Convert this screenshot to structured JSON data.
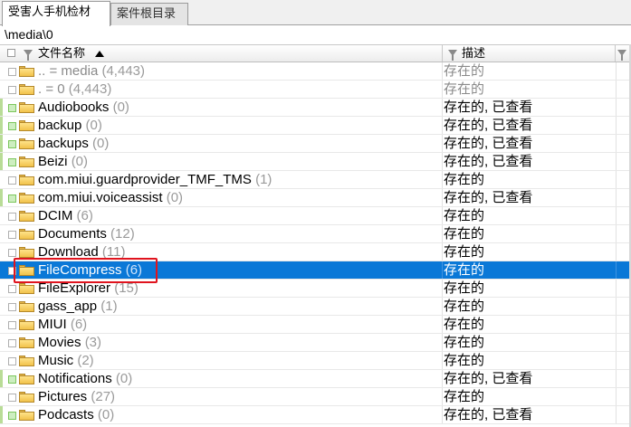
{
  "tabs": [
    {
      "label": "受害人手机检材",
      "active": true
    },
    {
      "label": "案件根目录",
      "active": false
    }
  ],
  "path": "\\media\\0",
  "header": {
    "name_label": "文件名称",
    "desc_label": "描述"
  },
  "rows": [
    {
      "name": "..  =  media",
      "count": "(4,443)",
      "desc": "存在的",
      "dim": true,
      "checked": false
    },
    {
      "name": ".  =  0",
      "count": "(4,443)",
      "desc": "存在的",
      "dim": true,
      "checked": false
    },
    {
      "name": "Audiobooks",
      "count": "(0)",
      "desc": "存在的, 已查看",
      "checked": true
    },
    {
      "name": "backup",
      "count": "(0)",
      "desc": "存在的, 已查看",
      "checked": true
    },
    {
      "name": "backups",
      "count": "(0)",
      "desc": "存在的, 已查看",
      "checked": true
    },
    {
      "name": "Beizi",
      "count": "(0)",
      "desc": "存在的, 已查看",
      "checked": true
    },
    {
      "name": "com.miui.guardprovider_TMF_TMS",
      "count": "(1)",
      "desc": "存在的",
      "checked": false
    },
    {
      "name": "com.miui.voiceassist",
      "count": "(0)",
      "desc": "存在的, 已查看",
      "checked": true
    },
    {
      "name": "DCIM",
      "count": "(6)",
      "desc": "存在的",
      "checked": false
    },
    {
      "name": "Documents",
      "count": "(12)",
      "desc": "存在的",
      "checked": false
    },
    {
      "name": "Download",
      "count": "(11)",
      "desc": "存在的",
      "checked": false
    },
    {
      "name": "FileCompress",
      "count": "(6)",
      "desc": "存在的",
      "checked": false,
      "selected": true
    },
    {
      "name": "FileExplorer",
      "count": "(15)",
      "desc": "存在的",
      "checked": false
    },
    {
      "name": "gass_app",
      "count": "(1)",
      "desc": "存在的",
      "checked": false
    },
    {
      "name": "MIUI",
      "count": "(6)",
      "desc": "存在的",
      "checked": false
    },
    {
      "name": "Movies",
      "count": "(3)",
      "desc": "存在的",
      "checked": false
    },
    {
      "name": "Music",
      "count": "(2)",
      "desc": "存在的",
      "checked": false
    },
    {
      "name": "Notifications",
      "count": "(0)",
      "desc": "存在的, 已查看",
      "checked": true
    },
    {
      "name": "Pictures",
      "count": "(27)",
      "desc": "存在的",
      "checked": false
    },
    {
      "name": "Podcasts",
      "count": "(0)",
      "desc": "存在的, 已查看",
      "checked": true
    }
  ],
  "colors": {
    "selection": "#0a78d7",
    "highlight_border": "#e0141e",
    "viewed_marker": "#b9dc97"
  },
  "icons": [
    "folder-icon",
    "filter-icon",
    "sort-ascending-icon"
  ]
}
